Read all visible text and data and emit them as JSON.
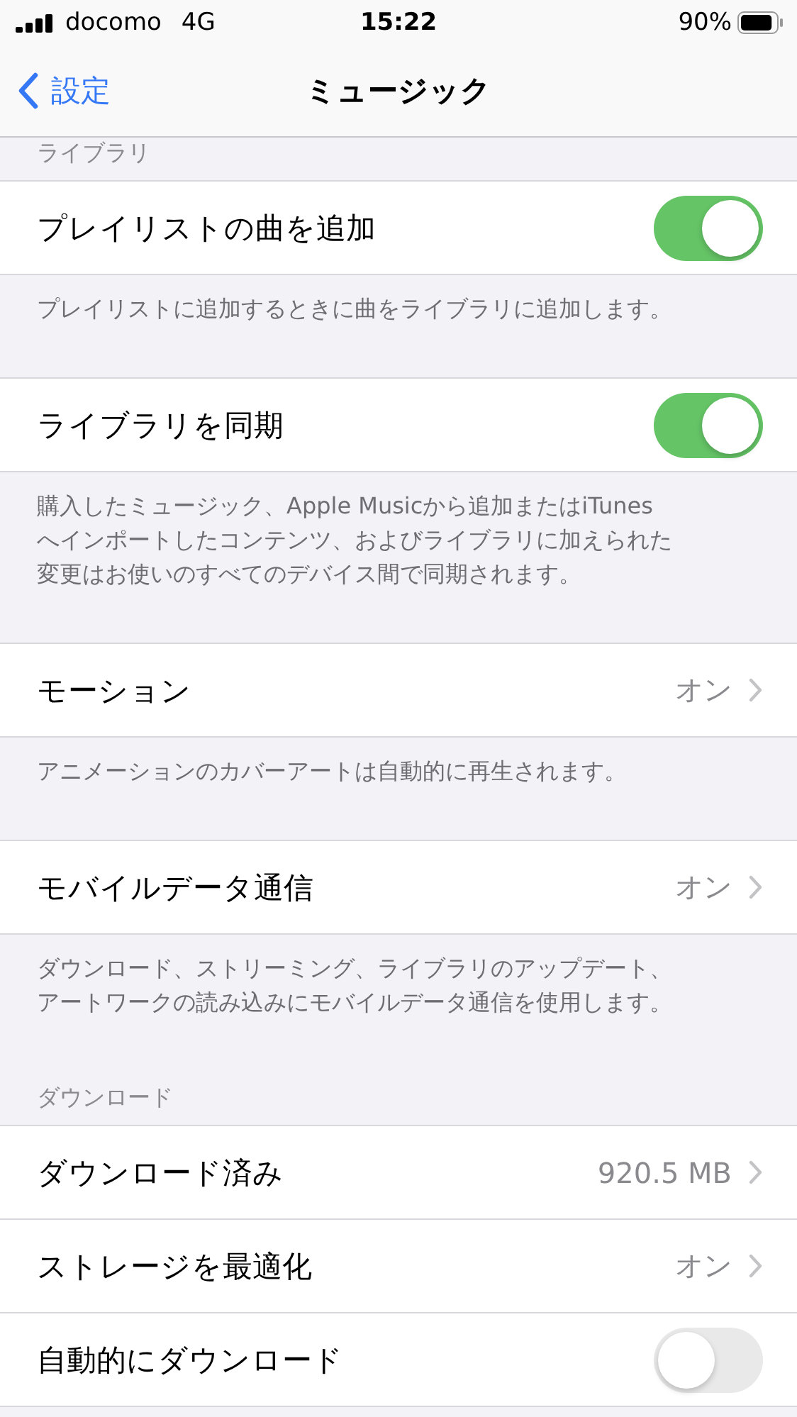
{
  "status_bar": {
    "carrier": "docomo",
    "network": "4G",
    "time": "15:22",
    "battery": "90%"
  },
  "nav": {
    "back": "設定",
    "title": "ミュージック"
  },
  "sections": [
    {
      "header": "ライブラリ",
      "rows": [
        {
          "kind": "toggle",
          "label": "プレイリストの曲を追加",
          "on": true
        }
      ],
      "footer": [
        "プレイリストに追加するときに曲をライブラリに追加します。"
      ]
    },
    {
      "rows": [
        {
          "kind": "toggle",
          "label": "ライブラリを同期",
          "on": true
        }
      ],
      "footer": [
        "購入したミュージック、Apple Musicから追加またはiTunes",
        "へインポートしたコンテンツ、およびライブラリに加えられた",
        "変更はお使いのすべてのデバイス間で同期されます。"
      ]
    },
    {
      "rows": [
        {
          "kind": "detail",
          "label": "モーション",
          "value": "オン"
        }
      ],
      "footer": [
        "アニメーションのカバーアートは自動的に再生されます。"
      ]
    },
    {
      "rows": [
        {
          "kind": "detail",
          "label": "モバイルデータ通信",
          "value": "オン"
        }
      ],
      "footer": [
        "ダウンロード、ストリーミング、ライブラリのアップデート、",
        "アートワークの読み込みにモバイルデータ通信を使用します。"
      ]
    },
    {
      "header": "ダウンロード",
      "rows": [
        {
          "kind": "detail",
          "label": "ダウンロード済み",
          "value": "920.5 MB"
        },
        {
          "kind": "detail",
          "label": "ストレージを最適化",
          "value": "オン"
        },
        {
          "kind": "toggle",
          "label": "自動的にダウンロード",
          "on": false
        }
      ]
    }
  ]
}
